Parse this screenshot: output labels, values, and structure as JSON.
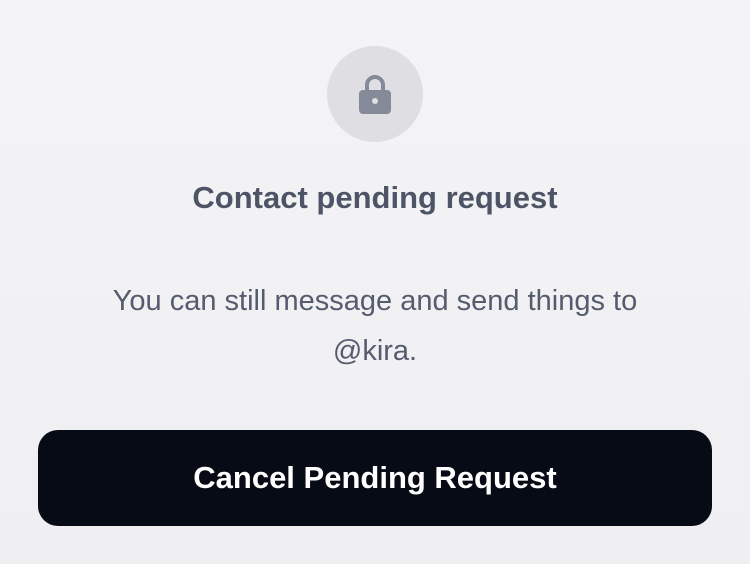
{
  "pending": {
    "icon": "lock-icon",
    "title": "Contact pending request",
    "message_line1": "You can still message and send things to",
    "message_line2": "@kira.",
    "button_label": "Cancel Pending Request"
  },
  "colors": {
    "background": "#f2f2f4",
    "icon_circle": "#dedee3",
    "icon": "#858a99",
    "title": "#4d5466",
    "message": "#555c6d",
    "button_bg": "#060b16",
    "button_text": "#ffffff"
  }
}
